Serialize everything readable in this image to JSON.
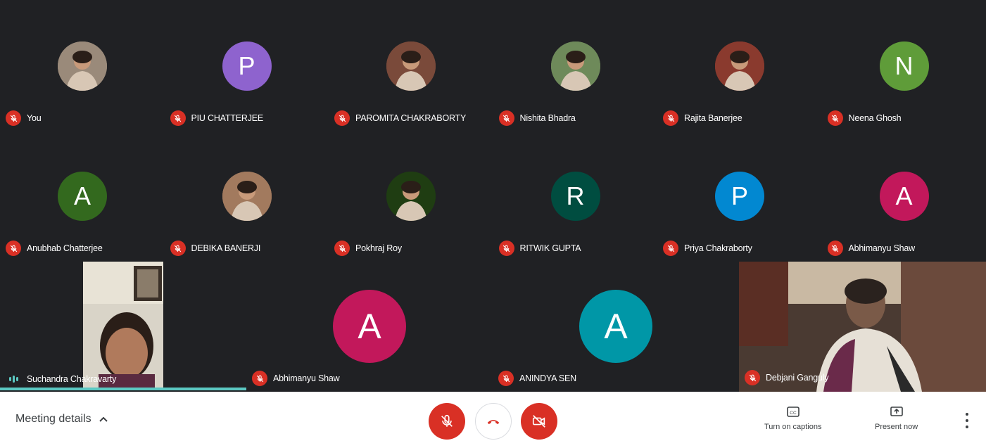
{
  "grid": [
    {
      "name": "You",
      "initial": "",
      "color": "#9a8a7a",
      "photo": true
    },
    {
      "name": "PIU CHATTERJEE",
      "initial": "P",
      "color": "#8e63ce",
      "photo": false
    },
    {
      "name": "PAROMITA CHAKRABORTY",
      "initial": "",
      "color": "#7a4a3a",
      "photo": true
    },
    {
      "name": "Nishita Bhadra",
      "initial": "",
      "color": "#6e8a5a",
      "photo": true
    },
    {
      "name": "Rajita Banerjee",
      "initial": "",
      "color": "#8a3a2e",
      "photo": true
    },
    {
      "name": "Neena Ghosh",
      "initial": "N",
      "color": "#5f9c39",
      "photo": false
    },
    {
      "name": "Anubhab Chatterjee",
      "initial": "A",
      "color": "#33691e",
      "photo": false
    },
    {
      "name": "DEBIKA BANERJI",
      "initial": "",
      "color": "#a27a5e",
      "photo": true
    },
    {
      "name": "Pokhraj Roy",
      "initial": "",
      "color": "#1f3d12",
      "photo": true
    },
    {
      "name": "RITWIK GUPTA",
      "initial": "R",
      "color": "#004d40",
      "photo": false
    },
    {
      "name": "Priya Chakraborty",
      "initial": "P",
      "color": "#0288d1",
      "photo": false
    },
    {
      "name": "Abhimanyu Shaw",
      "initial": "A",
      "color": "#c2185b",
      "photo": false
    }
  ],
  "bottom_row": {
    "left_video": {
      "name": "Suchandra Chakravarty",
      "speaking": true
    },
    "center": [
      {
        "name": "Abhimanyu Shaw",
        "initial": "A",
        "color": "#c2185b"
      },
      {
        "name": "ANINDYA SEN",
        "initial": "A",
        "color": "#0097a7"
      }
    ],
    "right_video": {
      "name": "Debjani Ganguly"
    }
  },
  "controls": {
    "meeting_details": "Meeting details",
    "captions_label": "Turn on captions",
    "present_label": "Present now",
    "mic_state": "off",
    "camera_state": "off"
  },
  "colors": {
    "stage_bg": "#202124",
    "danger": "#d93025",
    "accent": "#5bc8c2"
  }
}
